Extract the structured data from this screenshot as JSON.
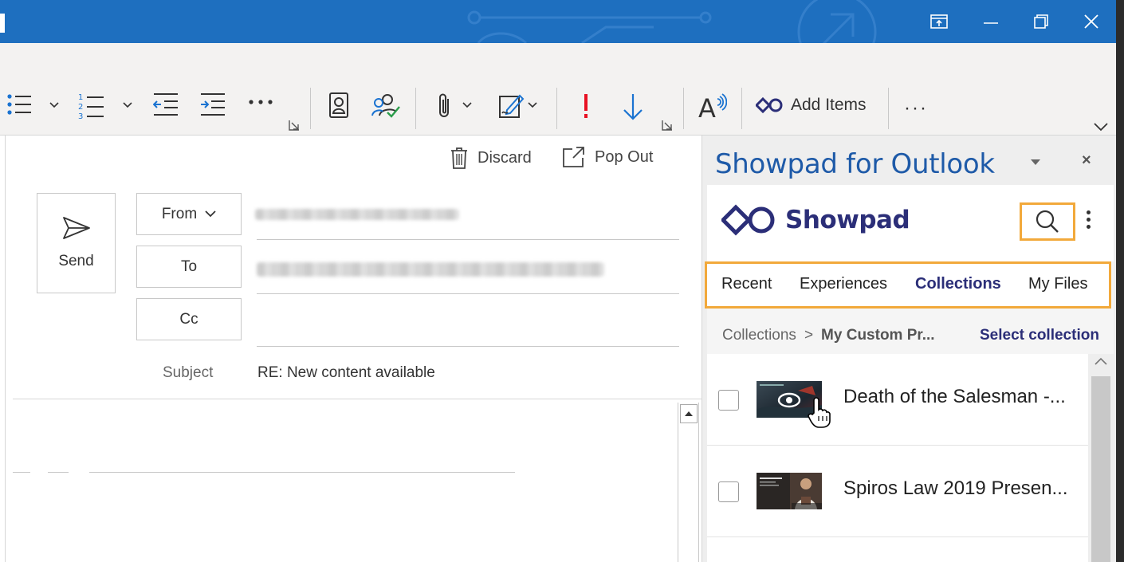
{
  "window": {
    "controls": [
      "restore-to-tab-icon",
      "minimize-icon",
      "restore-icon",
      "close-icon"
    ]
  },
  "ribbon": {
    "buttons": [
      "bullets-icon",
      "numbering-icon",
      "decrease-indent-icon",
      "increase-indent-icon",
      "more-icon",
      "address-book-icon",
      "check-names-icon",
      "attach-file-icon",
      "signature-icon",
      "high-importance-icon",
      "low-importance-icon",
      "read-aloud-icon"
    ],
    "add_items_label": "Add Items",
    "more_label": "···"
  },
  "compose": {
    "discard_label": "Discard",
    "popout_label": "Pop Out",
    "send_label": "Send",
    "from_label": "From",
    "to_label": "To",
    "cc_label": "Cc",
    "subject_label": "Subject",
    "subject_value": "RE: New content available"
  },
  "pane": {
    "title": "Showpad for Outlook",
    "close_label": "×",
    "logo_text": "Showpad",
    "tabs": [
      "Recent",
      "Experiences",
      "Collections",
      "My Files"
    ],
    "active_tab": "Collections",
    "breadcrumb_root": "Collections",
    "breadcrumb_sep": ">",
    "breadcrumb_current": "My Custom Pr...",
    "select_collection_label": "Select collection",
    "items": [
      {
        "title": "Death of the Salesman -..."
      },
      {
        "title": "Spiros Law 2019 Presen..."
      }
    ]
  },
  "colors": {
    "titlebar": "#1e6fbf",
    "accent_blue": "#1e5aa8",
    "showpad_navy": "#2b2e78",
    "highlight_orange": "#f2a93b",
    "importance_red": "#e81123"
  }
}
